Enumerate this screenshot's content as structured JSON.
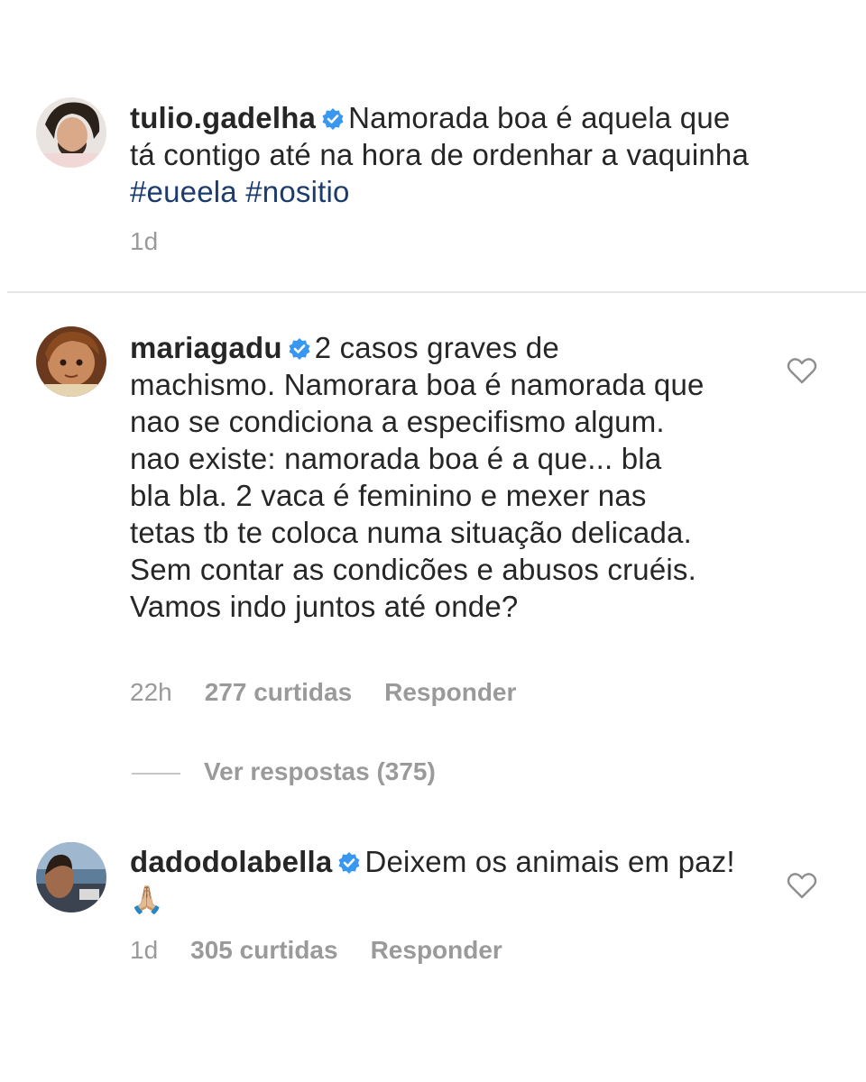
{
  "comments": [
    {
      "username": "tulio.gadelha",
      "text": "Namorada boa é aquela que tá contigo até na hora de ordenhar a vaquinha",
      "hashtags": [
        "#eueela",
        "#nositio"
      ],
      "time": "1d"
    },
    {
      "username": "mariagadu",
      "text": "2 casos graves de machismo. Namorara boa é namorada que nao se condiciona a especifismo algum. nao existe: namorada boa é a que... bla bla bla. 2 vaca é feminino e mexer nas tetas tb te coloca numa situação delicada. Sem contar as condicões e abusos cruéis. Vamos indo juntos até onde?",
      "time": "22h",
      "likes": "277 curtidas",
      "reply_label": "Responder",
      "view_replies": "Ver respostas (375)"
    },
    {
      "username": "dadodolabella",
      "text": "Deixem os animais em paz!",
      "emoji": "🙏🏼",
      "time": "1d",
      "likes": "305 curtidas",
      "reply_label": "Responder"
    }
  ],
  "icons": {
    "verified": "verified-badge-icon",
    "like": "heart-outline-icon"
  },
  "colors": {
    "verified": "#3897f0",
    "hashtag": "#1d3c6e",
    "meta": "#9a9a9a"
  }
}
